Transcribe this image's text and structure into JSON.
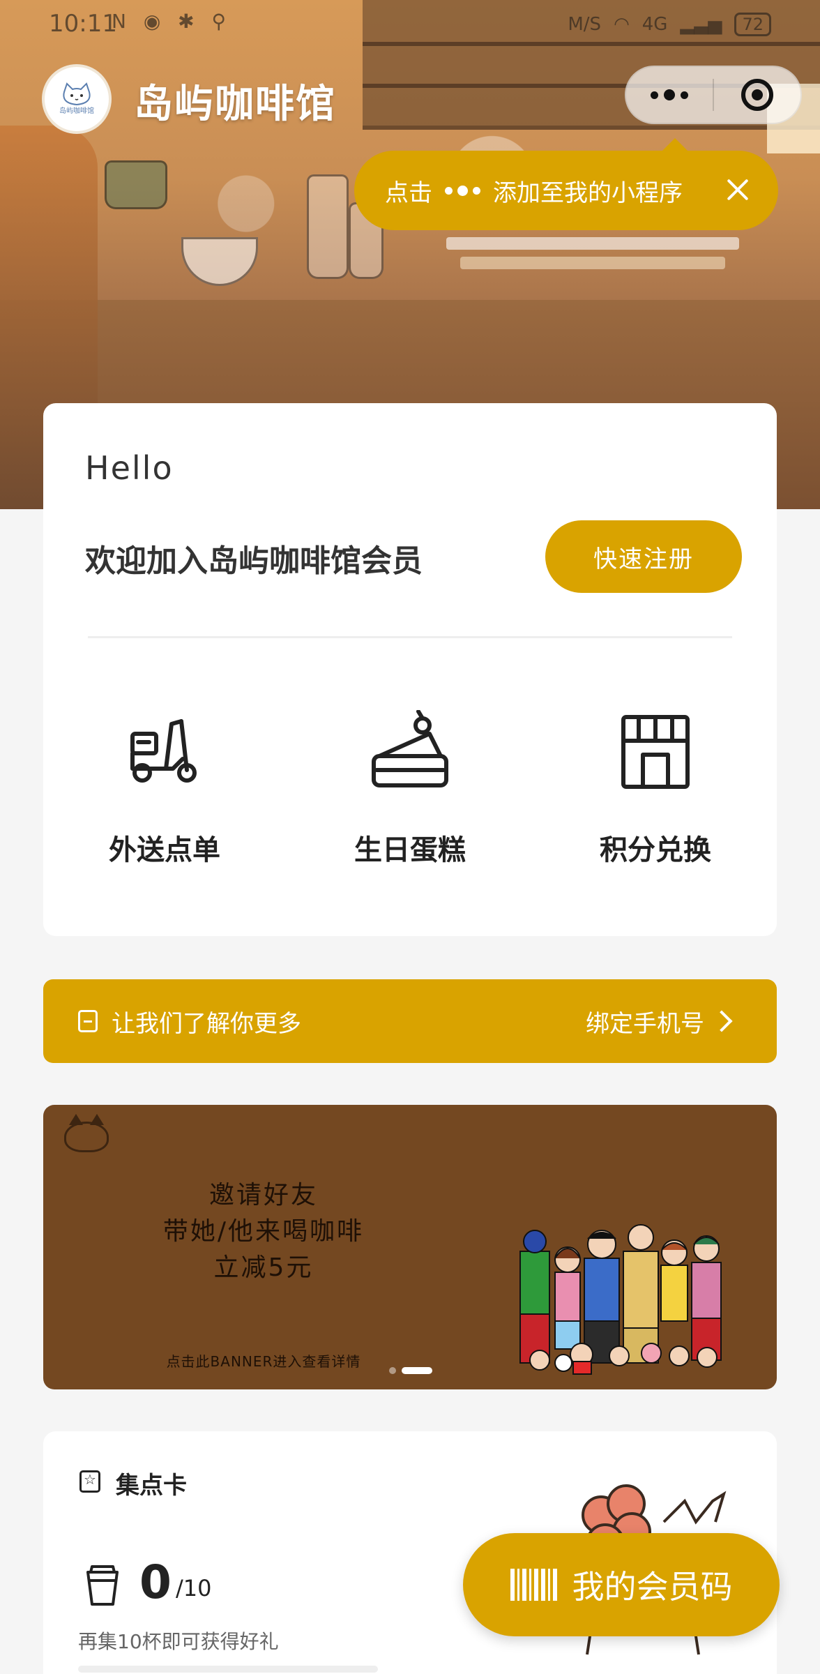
{
  "status_bar": {
    "time": "10:11",
    "left_icons": "N ◉ ✱ ⚲",
    "speed": "M/S",
    "network": "4G",
    "battery": "72"
  },
  "nav": {
    "title": "岛屿咖啡馆",
    "logo_text": "岛屿咖啡馆"
  },
  "tooltip": {
    "prefix": "点击",
    "suffix": "添加至我的小程序"
  },
  "member": {
    "greeting": "Hello",
    "welcome": "欢迎加入岛屿咖啡馆会员",
    "register_button": "快速注册"
  },
  "features": [
    {
      "label": "外送点单",
      "icon": "delivery-scooter-icon"
    },
    {
      "label": "生日蛋糕",
      "icon": "cake-icon"
    },
    {
      "label": "积分兑换",
      "icon": "store-icon"
    }
  ],
  "info_bar": {
    "text": "让我们了解你更多",
    "link": "绑定手机号"
  },
  "banner": {
    "line1": "邀请好友",
    "line2": "带她/他来喝咖啡",
    "line3": "立减5元",
    "detail": "点击此BANNER进入查看详情",
    "slide_count": 2,
    "active_slide": 2
  },
  "stamp_card": {
    "title": "集点卡",
    "count": "0",
    "total": "/10",
    "progress": 0,
    "hint": "再集10杯即可获得好礼"
  },
  "member_code_button": "我的会员码",
  "colors": {
    "accent": "#d9a300",
    "banner_bg": "#744821",
    "page_bg": "#f5f5f5"
  }
}
